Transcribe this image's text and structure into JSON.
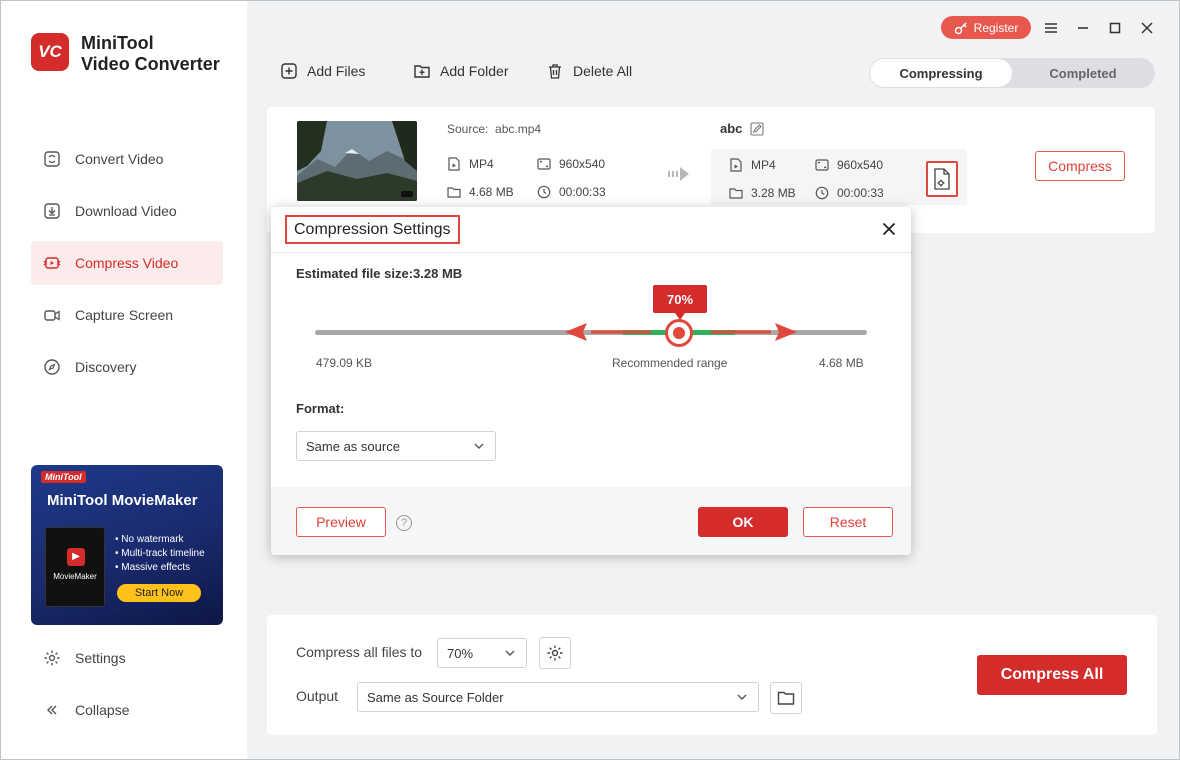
{
  "app": {
    "logo_text": "VC",
    "name_line1": "MiniTool",
    "name_line2": "Video Converter"
  },
  "sidebar": {
    "items": [
      {
        "label": "Convert Video",
        "icon": "convert-icon"
      },
      {
        "label": "Download Video",
        "icon": "download-icon"
      },
      {
        "label": "Compress Video",
        "icon": "compress-icon",
        "active": true
      },
      {
        "label": "Capture Screen",
        "icon": "camera-icon"
      },
      {
        "label": "Discovery",
        "icon": "compass-icon"
      }
    ],
    "promo": {
      "brand": "MiniTool",
      "title": "MiniTool MovieMaker",
      "box_name": "MovieMaker",
      "features": [
        "No watermark",
        "Multi-track timeline",
        "Massive effects"
      ],
      "cta": "Start Now"
    },
    "settings_label": "Settings",
    "collapse_label": "Collapse"
  },
  "titlebar": {
    "register_label": "Register"
  },
  "toolbar": {
    "add_files": "Add Files",
    "add_folder": "Add Folder",
    "delete_all": "Delete All"
  },
  "tabs": {
    "compressing": "Compressing",
    "completed": "Completed"
  },
  "file": {
    "source_label": "Source:",
    "source_name": "abc.mp4",
    "source_format": "MP4",
    "source_resolution": "960x540",
    "source_size": "4.68 MB",
    "source_duration": "00:00:33",
    "output_name": "abc",
    "output_format": "MP4",
    "output_resolution": "960x540",
    "output_size": "3.28 MB",
    "output_duration": "00:00:33",
    "compress_label": "Compress"
  },
  "dialog": {
    "title": "Compression Settings",
    "estimated_label": "Estimated file size:3.28 MB",
    "slider_percent": 70,
    "slider_badge": "70%",
    "min_label": "479.09 KB",
    "recommended_label": "Recommended range",
    "max_label": "4.68 MB",
    "format_label": "Format:",
    "format_value": "Same as source",
    "preview_label": "Preview",
    "help_label": "?",
    "ok_label": "OK",
    "reset_label": "Reset"
  },
  "bottom": {
    "compress_all_to_label": "Compress all files to",
    "compress_value": "70%",
    "output_label": "Output",
    "output_value": "Same as Source Folder",
    "compress_all_label": "Compress All"
  },
  "colors": {
    "accent": "#d42b2b",
    "recommended": "#2fb15a"
  }
}
